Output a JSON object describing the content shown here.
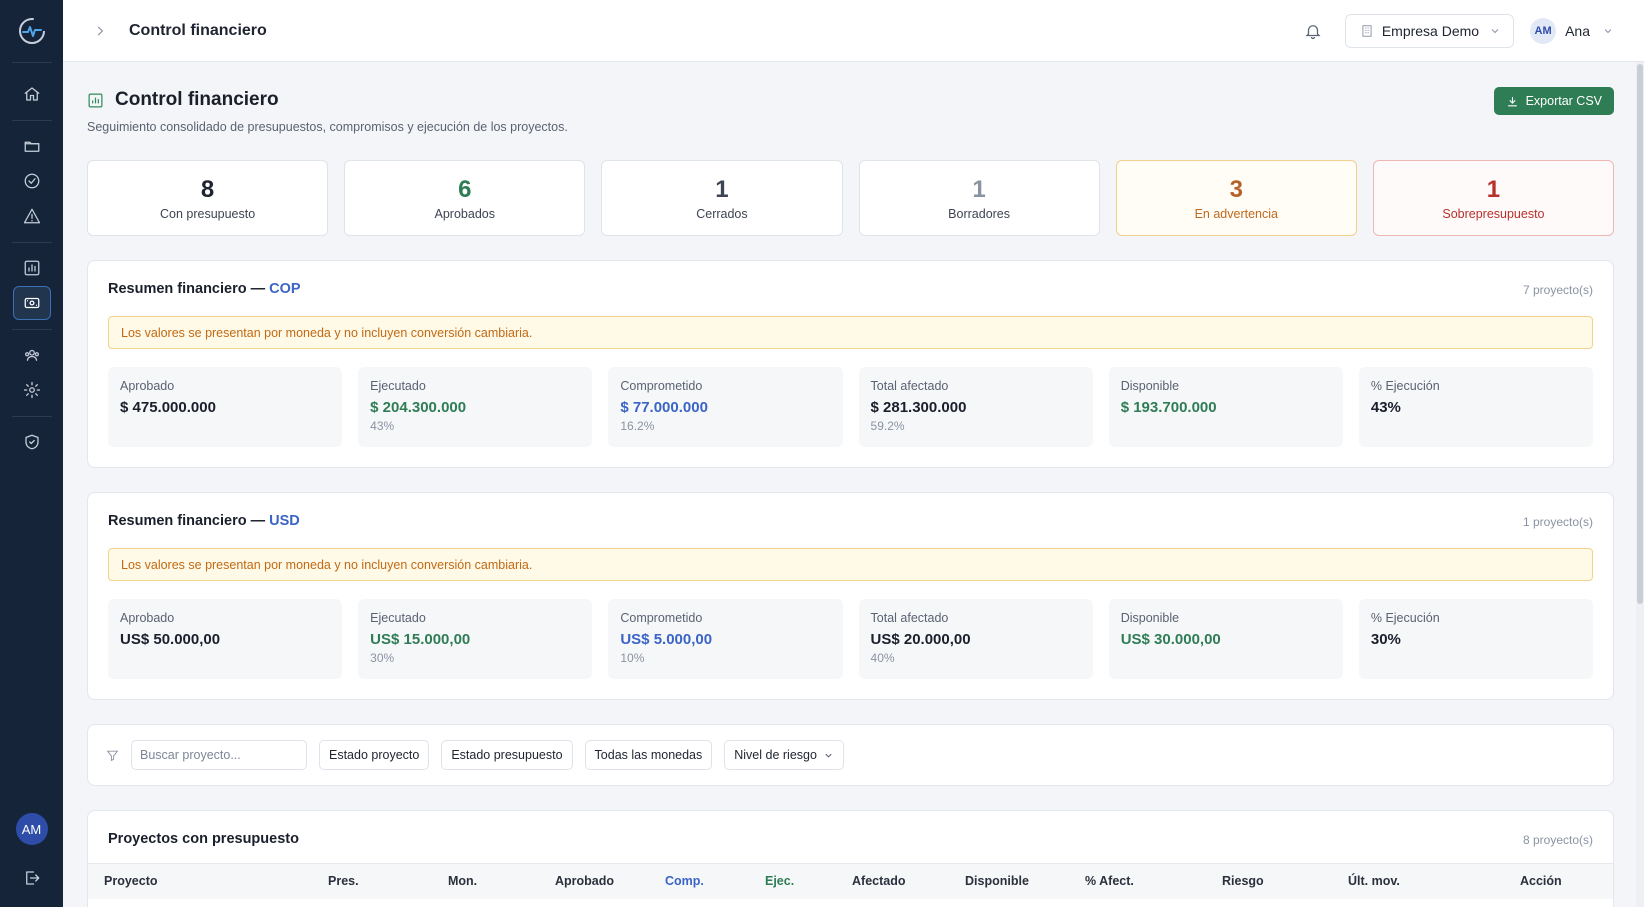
{
  "topbar": {
    "title": "Control financiero",
    "company": "Empresa Demo",
    "user_initials": "AM",
    "user_name": "Ana"
  },
  "sidebar": {
    "avatar_initials": "AM",
    "items": [
      {
        "icon": "home-icon"
      },
      {
        "icon": "folder-icon"
      },
      {
        "icon": "check-circle-icon"
      },
      {
        "icon": "alert-triangle-icon"
      },
      {
        "icon": "chart-icon"
      },
      {
        "icon": "money-icon",
        "active": true
      },
      {
        "icon": "team-icon"
      },
      {
        "icon": "gear-icon"
      },
      {
        "icon": "shield-check-icon"
      }
    ]
  },
  "page": {
    "title": "Control financiero",
    "subtitle": "Seguimiento consolidado de presupuestos, compromisos y ejecución de los proyectos.",
    "export_label": "Exportar CSV"
  },
  "stats": [
    {
      "value": "8",
      "label": "Con presupuesto"
    },
    {
      "value": "6",
      "label": "Aprobados"
    },
    {
      "value": "1",
      "label": "Cerrados"
    },
    {
      "value": "1",
      "label": "Borradores"
    },
    {
      "value": "3",
      "label": "En advertencia"
    },
    {
      "value": "1",
      "label": "Sobrepresupuesto"
    }
  ],
  "summaries": [
    {
      "title_prefix": "Resumen financiero — ",
      "currency": "COP",
      "count": "7 proyecto(s)",
      "notice": "Los valores se presentan por moneda y no incluyen conversión cambiaria.",
      "metrics": [
        {
          "label": "Aprobado",
          "value": "$ 475.000.000",
          "sub": ""
        },
        {
          "label": "Ejecutado",
          "value": "$ 204.300.000",
          "sub": "43%"
        },
        {
          "label": "Comprometido",
          "value": "$ 77.000.000",
          "sub": "16.2%"
        },
        {
          "label": "Total afectado",
          "value": "$ 281.300.000",
          "sub": "59.2%"
        },
        {
          "label": "Disponible",
          "value": "$ 193.700.000",
          "sub": ""
        },
        {
          "label": "% Ejecución",
          "value": "43%",
          "sub": ""
        }
      ]
    },
    {
      "title_prefix": "Resumen financiero — ",
      "currency": "USD",
      "count": "1 proyecto(s)",
      "notice": "Los valores se presentan por moneda y no incluyen conversión cambiaria.",
      "metrics": [
        {
          "label": "Aprobado",
          "value": "US$ 50.000,00",
          "sub": ""
        },
        {
          "label": "Ejecutado",
          "value": "US$ 15.000,00",
          "sub": "30%"
        },
        {
          "label": "Comprometido",
          "value": "US$ 5.000,00",
          "sub": "10%"
        },
        {
          "label": "Total afectado",
          "value": "US$ 20.000,00",
          "sub": "40%"
        },
        {
          "label": "Disponible",
          "value": "US$ 30.000,00",
          "sub": ""
        },
        {
          "label": "% Ejecución",
          "value": "30%",
          "sub": ""
        }
      ]
    }
  ],
  "filters": {
    "search_placeholder": "Buscar proyecto...",
    "project_status": "Estado proyecto",
    "budget_status": "Estado presupuesto",
    "currency": "Todas las monedas",
    "risk": "Nivel de riesgo"
  },
  "table": {
    "title": "Proyectos con presupuesto",
    "count": "8 proyecto(s)",
    "columns": [
      "Proyecto",
      "Pres.",
      "Mon.",
      "Aprobado",
      "Comp.",
      "Ejec.",
      "Afectado",
      "Disponible",
      "% Afect.",
      "Riesgo",
      "Últ. mov.",
      "Acción"
    ]
  },
  "colors": {
    "sidebar": "#16243a",
    "accent_green": "#2f7d55",
    "accent_blue": "#3a64c6",
    "warning": "#c0691e",
    "danger": "#b8302a"
  }
}
